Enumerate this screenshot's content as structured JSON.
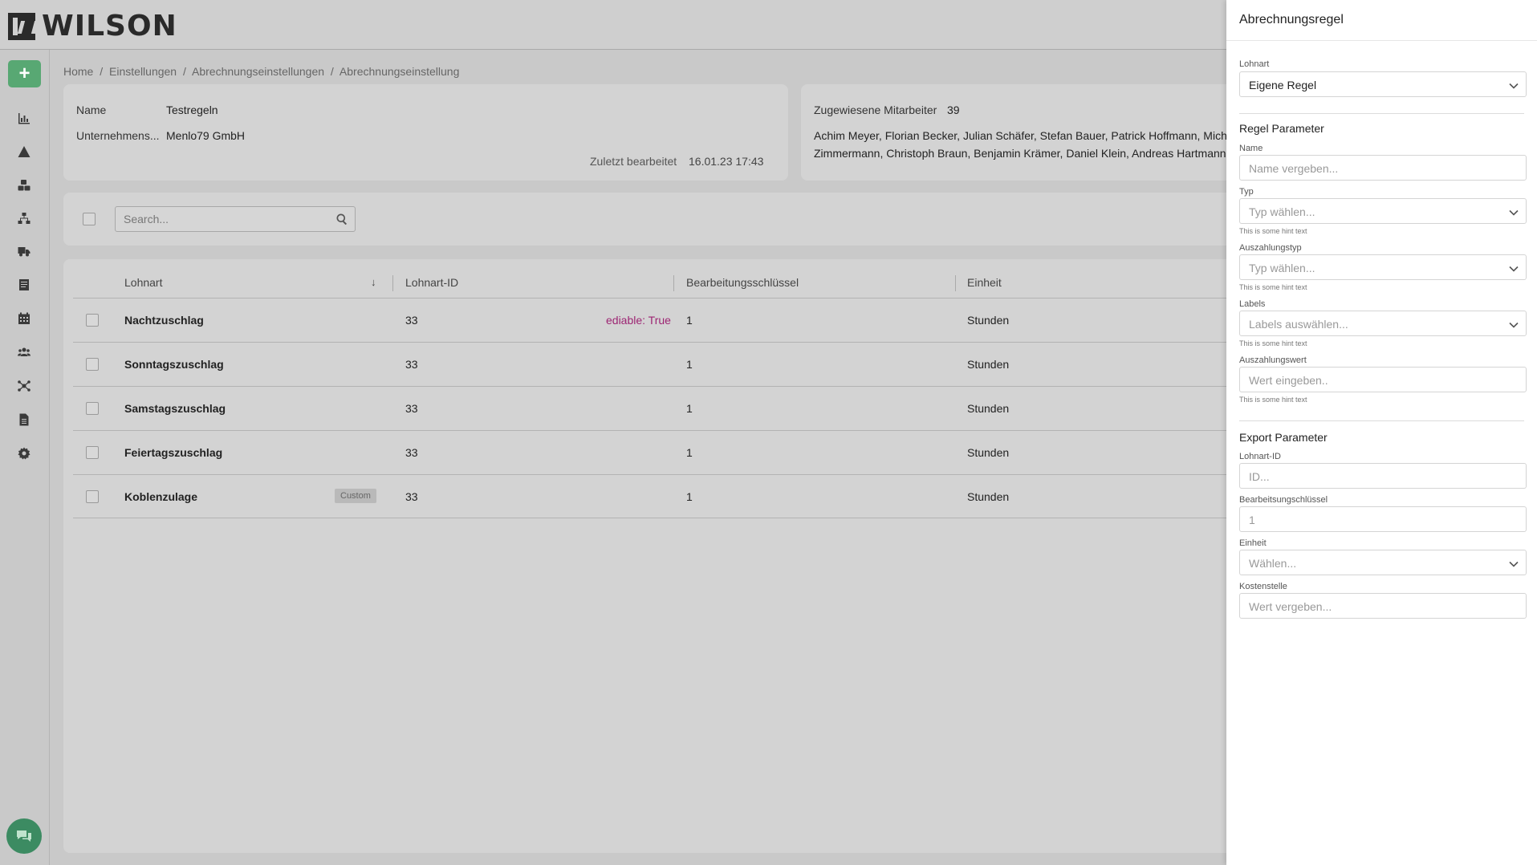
{
  "app": {
    "logo_text": "WILSON",
    "add_label": "+"
  },
  "breadcrumb": [
    "Home",
    "/",
    "Einstellungen",
    "/",
    "Abrechnungseinstellungen",
    "/",
    "Abrechnungseinstellung"
  ],
  "info": {
    "name_label": "Name",
    "name_value": "Testregeln",
    "company_label": "Unternehmens...",
    "company_value": "Menlo79 GmbH",
    "edited_label": "Zuletzt bearbeitet",
    "edited_value": "16.01.23 17:43"
  },
  "employees": {
    "label": "Zugewiesene Mitarbeiter",
    "count": "39",
    "line1": "Achim Meyer, Florian Becker, Julian Schäfer, Stefan Bauer, Patrick Hoffmann, Micha",
    "line2": "Zimmermann, Christoph Braun, Benjamin Krämer, Daniel Klein, Andreas Hartmann, S"
  },
  "search": {
    "placeholder": "Search..."
  },
  "table": {
    "headers": {
      "lohnart": "Lohnart",
      "lohnart_id": "Lohnart-ID",
      "key": "Bearbeitungsschlüssel",
      "unit": "Einheit"
    },
    "rows": [
      {
        "name": "Nachtzuschlag",
        "id": "33",
        "tag": "ediable: True",
        "key": "1",
        "unit": "Stunden"
      },
      {
        "name": "Sonntagszuschlag",
        "id": "33",
        "key": "1",
        "unit": "Stunden"
      },
      {
        "name": "Samstagszuschlag",
        "id": "33",
        "key": "1",
        "unit": "Stunden"
      },
      {
        "name": "Feiertagszuschlag",
        "id": "33",
        "key": "1",
        "unit": "Stunden"
      },
      {
        "name": "Koblenzulage",
        "id": "33",
        "badge": "Custom",
        "key": "1",
        "unit": "Stunden"
      }
    ]
  },
  "panel": {
    "title": "Abrechnungsregel",
    "lohnart": {
      "label": "Lohnart",
      "value": "Eigene Regel"
    },
    "regel_title": "Regel Parameter",
    "name": {
      "label": "Name",
      "placeholder": "Name vergeben..."
    },
    "typ": {
      "label": "Typ",
      "placeholder": "Typ wählen...",
      "hint": "This is some hint text"
    },
    "auszahlungstyp": {
      "label": "Auszahlungstyp",
      "placeholder": "Typ wählen...",
      "hint": "This is some hint text"
    },
    "labels": {
      "label": "Labels",
      "placeholder": "Labels auswählen...",
      "hint": "This is some hint text"
    },
    "auszahlungswert": {
      "label": "Auszahlungswert",
      "placeholder": "Wert eingeben..",
      "hint": "This is some hint text"
    },
    "export_title": "Export Parameter",
    "lohnart_id": {
      "label": "Lohnart-ID",
      "placeholder": "ID..."
    },
    "bearbeitungsschluessel": {
      "label": "Bearbeitsungschlüssel",
      "placeholder": "1"
    },
    "einheit": {
      "label": "Einheit",
      "placeholder": "Wählen..."
    },
    "kostenstelle": {
      "label": "Kostenstelle",
      "placeholder": "Wert vergeben..."
    }
  }
}
